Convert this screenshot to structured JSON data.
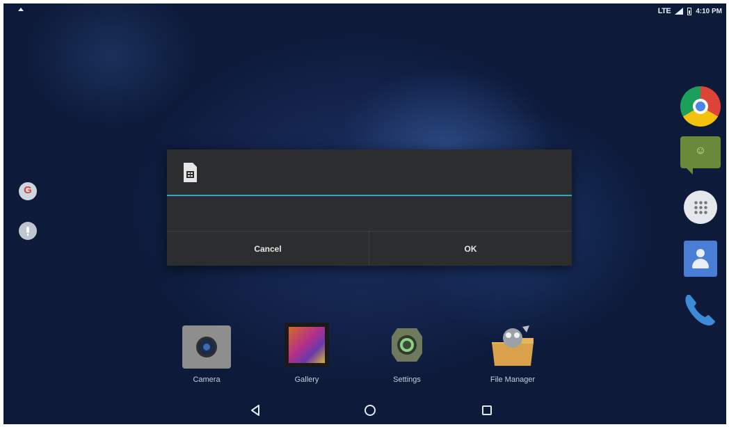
{
  "status_bar": {
    "network": "LTE",
    "time": "4:10 PM",
    "icons": [
      "notification-icon",
      "signal-icon",
      "battery-icon"
    ]
  },
  "left_dock": {
    "icons": [
      "google-search-icon",
      "voice-search-icon"
    ],
    "google_letter": "G"
  },
  "right_dock": {
    "icons": [
      "chrome-icon",
      "messaging-icon",
      "app-drawer-icon",
      "contacts-icon",
      "phone-icon"
    ],
    "messaging_glyph": "☺"
  },
  "dialog": {
    "icon": "sim-card-icon",
    "cancel_label": "Cancel",
    "ok_label": "OK",
    "accent_color": "#3aa7b9"
  },
  "home_apps": [
    {
      "label": "Camera",
      "icon": "camera-icon"
    },
    {
      "label": "Gallery",
      "icon": "gallery-icon"
    },
    {
      "label": "Settings",
      "icon": "settings-icon"
    },
    {
      "label": "File Manager",
      "icon": "file-manager-icon"
    }
  ],
  "nav_bar": {
    "buttons": [
      "back-icon",
      "home-icon",
      "recents-icon"
    ]
  }
}
